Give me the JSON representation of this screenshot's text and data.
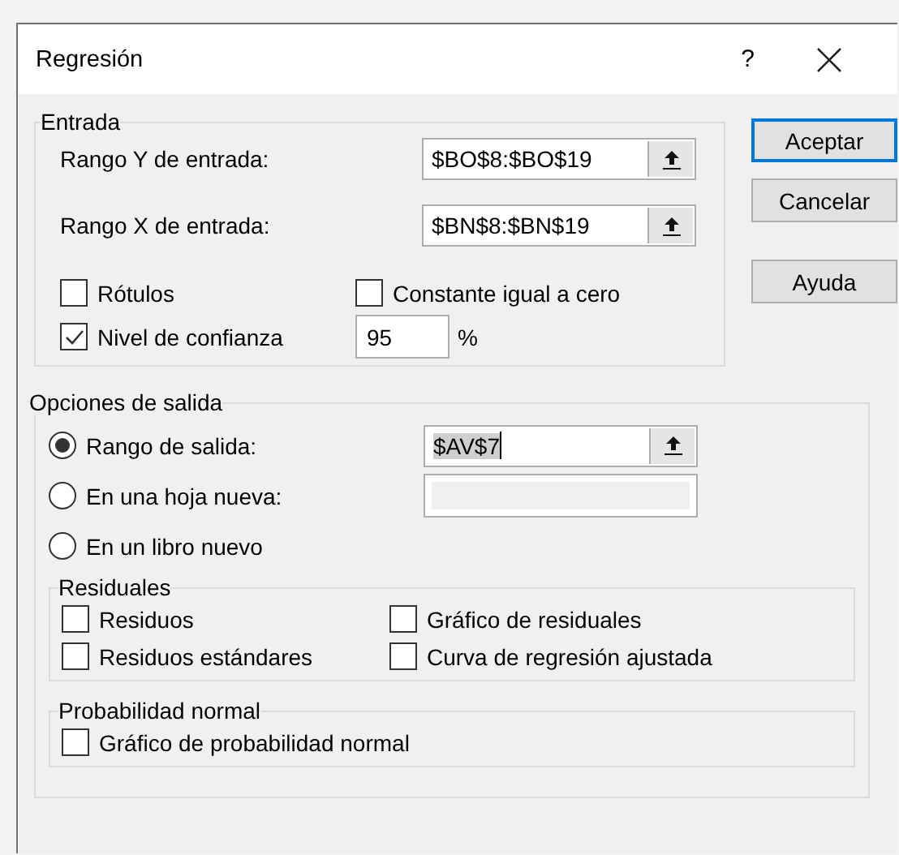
{
  "window": {
    "title": "Regresión",
    "help": "?"
  },
  "input_group": {
    "title": "Entrada",
    "ranges": [
      {
        "label": "Rango Y de entrada:",
        "value": "$BO$8:$BO$19"
      },
      {
        "label": "Rango X de entrada:",
        "value": "$BN$8:$BN$19"
      }
    ],
    "options": [
      {
        "label": "Rótulos",
        "checked": false
      },
      {
        "label": "Constante igual a cero",
        "checked": false
      },
      {
        "label": "Nivel de confianza",
        "checked": true
      }
    ],
    "confidence": {
      "value": "95",
      "unit": "%"
    }
  },
  "buttons": [
    {
      "label": "Aceptar",
      "default": true
    },
    {
      "label": "Cancelar",
      "default": false
    },
    {
      "label": "Ayuda",
      "default": false
    }
  ],
  "output_group": {
    "title": "Opciones de salida",
    "destinations": [
      {
        "label": "Rango de salida:",
        "selected": true,
        "field": {
          "kind": "range",
          "value": "$AV$7",
          "highlighted": true
        }
      },
      {
        "label": "En una hoja nueva:",
        "selected": false,
        "field": {
          "kind": "text",
          "disabled": true
        }
      },
      {
        "label": "En un libro nuevo",
        "selected": false
      }
    ],
    "residuals": {
      "title": "Residuales",
      "options": [
        {
          "label": "Residuos",
          "checked": false
        },
        {
          "label": "Gráfico de residuales",
          "checked": false
        },
        {
          "label": "Residuos estándares",
          "checked": false
        },
        {
          "label": "Curva de regresión ajustada",
          "checked": false
        }
      ]
    },
    "normal_probability": {
      "title": "Probabilidad normal",
      "options": [
        {
          "label": "Gráfico de probabilidad normal",
          "checked": false
        }
      ]
    }
  }
}
